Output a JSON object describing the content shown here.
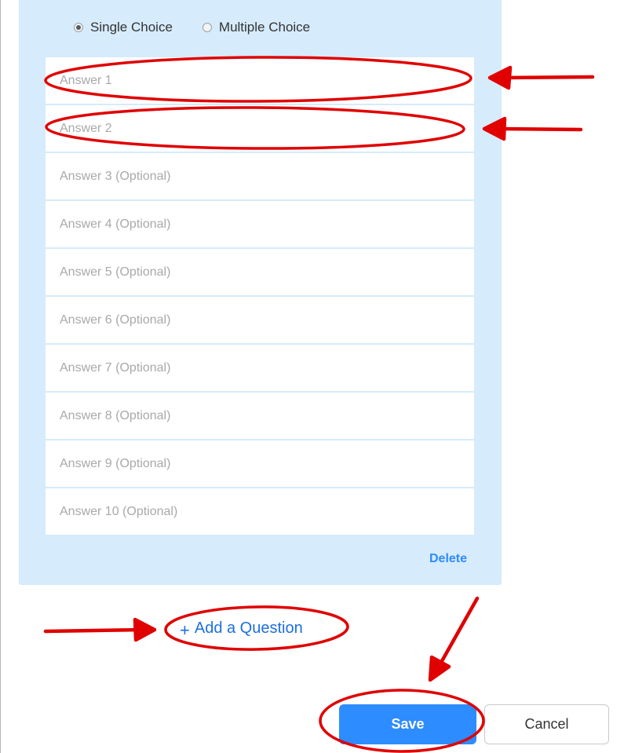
{
  "poll": {
    "choice_types": [
      {
        "label": "Single Choice",
        "selected": true
      },
      {
        "label": "Multiple Choice",
        "selected": false
      }
    ],
    "answers": [
      {
        "placeholder": "Answer 1",
        "value": ""
      },
      {
        "placeholder": "Answer 2",
        "value": ""
      },
      {
        "placeholder": "Answer 3 (Optional)",
        "value": ""
      },
      {
        "placeholder": "Answer 4 (Optional)",
        "value": ""
      },
      {
        "placeholder": "Answer 5 (Optional)",
        "value": ""
      },
      {
        "placeholder": "Answer 6 (Optional)",
        "value": ""
      },
      {
        "placeholder": "Answer 7 (Optional)",
        "value": ""
      },
      {
        "placeholder": "Answer 8 (Optional)",
        "value": ""
      },
      {
        "placeholder": "Answer 9 (Optional)",
        "value": ""
      },
      {
        "placeholder": "Answer 10 (Optional)",
        "value": ""
      }
    ],
    "delete_label": "Delete"
  },
  "add_question": {
    "icon": "plus-icon",
    "label": "Add a Question"
  },
  "footer": {
    "save_label": "Save",
    "cancel_label": "Cancel"
  },
  "colors": {
    "panel_bg": "#d6ebfb",
    "accent": "#2d8cff",
    "annotation": "#e00000"
  }
}
